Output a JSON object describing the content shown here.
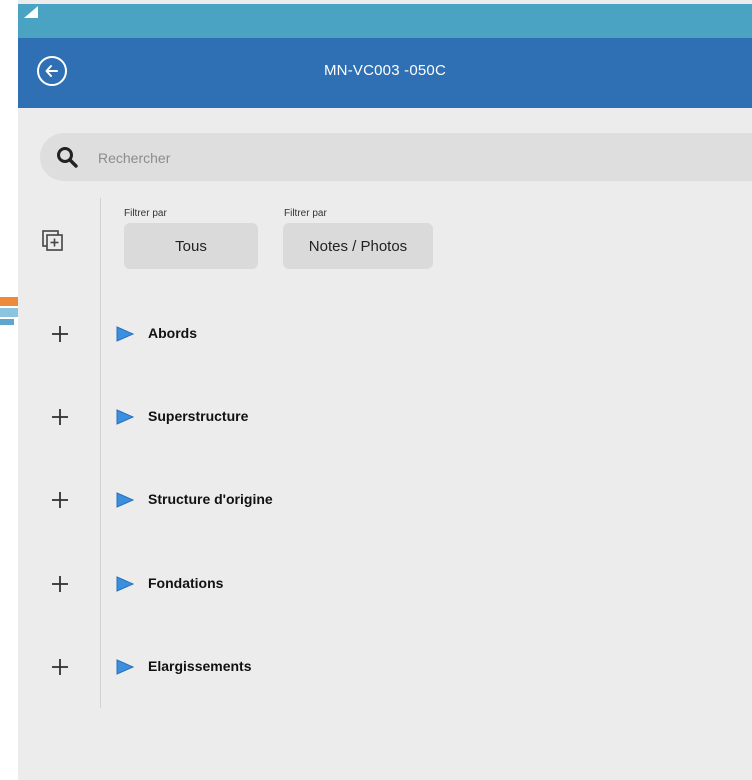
{
  "colors": {
    "status_bar": "#4aa3c2",
    "app_bar": "#2f6fb3",
    "background": "#ececec",
    "accent_play": "#3a8fe0"
  },
  "header": {
    "title": "MN-VC003 -050C",
    "back_icon": "back-arrow-circle-icon"
  },
  "search": {
    "placeholder": "Rechercher",
    "value": "",
    "icon": "search-icon"
  },
  "filters": [
    {
      "label": "Filtrer par",
      "value": "Tous"
    },
    {
      "label": "Filtrer par",
      "value": "Notes / Photos"
    }
  ],
  "tree": {
    "items": [
      {
        "label": "Abords"
      },
      {
        "label": "Superstructure"
      },
      {
        "label": "Structure d'origine"
      },
      {
        "label": "Fondations"
      },
      {
        "label": "Elargissements"
      }
    ]
  }
}
